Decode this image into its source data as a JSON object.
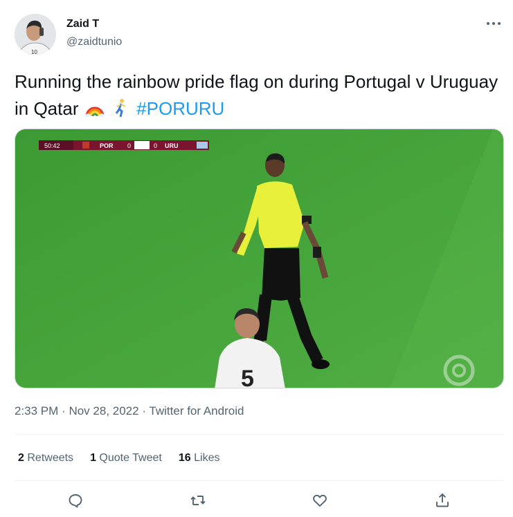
{
  "author": {
    "name": "Zaid T",
    "handle": "@zaidtunio"
  },
  "tweet": {
    "text_before": "Running the rainbow pride flag on during Portugal v Uruguay in Qatar",
    "emojis": [
      "rainbow-emoji",
      "person-running-emoji"
    ],
    "hashtag": "#PORURU"
  },
  "media": {
    "scorebug": {
      "clock": "50:42",
      "home_team": "POR",
      "home_score": "0",
      "away_score": "0",
      "away_team": "URU"
    },
    "player_number": "5"
  },
  "meta": {
    "time": "2:33 PM",
    "date": "Nov 28, 2022",
    "source": "Twitter for Android",
    "separator": "·"
  },
  "stats": {
    "retweets_count": "2",
    "retweets_label": "Retweets",
    "quotes_count": "1",
    "quotes_label": "Quote Tweet",
    "likes_count": "16",
    "likes_label": "Likes"
  },
  "colors": {
    "accent": "#1d9bf0",
    "pitch": "#3f9c35",
    "referee_shirt": "#e8f03a"
  },
  "icons": [
    "more-icon",
    "reply-icon",
    "retweet-icon",
    "like-icon",
    "share-icon"
  ]
}
